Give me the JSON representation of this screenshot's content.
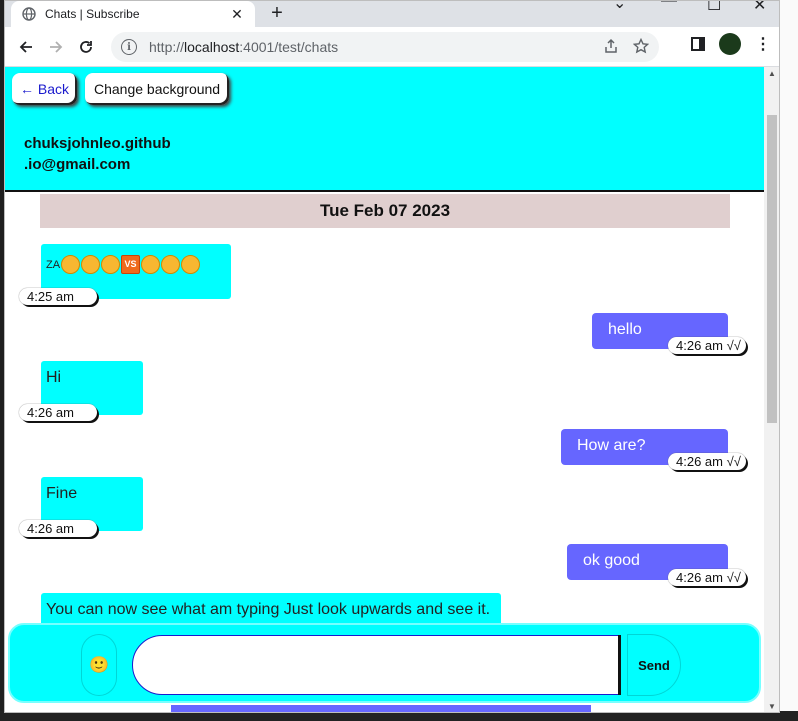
{
  "browser": {
    "tab_title": "Chats | Subscribe",
    "tab_close": "✕",
    "new_tab": "+",
    "url_host": "localhost",
    "url_prefix": "http://",
    "url_rest": ":4001/test/chats",
    "min_glyph": "⌄",
    "minimize_glyph": "—",
    "maximize_glyph": "☐",
    "close_glyph": "✕"
  },
  "header": {
    "back_label": "← Back",
    "change_bg_label": "Change background",
    "email_line1": "chuksjohnleo.github",
    "email_line2": ".io@gmail.com"
  },
  "date_banner": "Tue Feb 07 2023",
  "messages": [
    {
      "dir": "in",
      "text": "ZA",
      "emojis": [
        "😍",
        "😍",
        "🤩",
        "VS",
        "😘",
        "😶",
        "😛"
      ],
      "time": "4:25 am"
    },
    {
      "dir": "out",
      "text": "hello",
      "time": "4:26 am √√"
    },
    {
      "dir": "in",
      "text": "Hi",
      "time": "4:26 am"
    },
    {
      "dir": "out",
      "text": "How are?",
      "time": "4:26 am √√"
    },
    {
      "dir": "in",
      "text": "Fine",
      "time": "4:26 am"
    },
    {
      "dir": "out",
      "text": "ok good",
      "time": "4:26 am √√"
    },
    {
      "dir": "in",
      "text": "You can now see what am typing Just look upwards and see it."
    }
  ],
  "composer": {
    "emoji_glyph": "🙂",
    "input_value": "",
    "input_placeholder": "",
    "send_label": "Send"
  },
  "colors": {
    "accent_cyan": "#00ffff",
    "outgoing_bubble": "#6666ff",
    "date_banner_bg": "#e0cfcf"
  }
}
